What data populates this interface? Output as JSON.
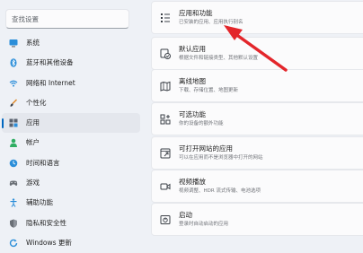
{
  "search": {
    "placeholder": "查找设置"
  },
  "sidebar": {
    "items": [
      {
        "label": "系统",
        "icon": "monitor-icon"
      },
      {
        "label": "蓝牙和其他设备",
        "icon": "bluetooth-icon"
      },
      {
        "label": "网络和 Internet",
        "icon": "wifi-icon"
      },
      {
        "label": "个性化",
        "icon": "paintbrush-icon"
      },
      {
        "label": "应用",
        "icon": "apps-icon",
        "active": true
      },
      {
        "label": "帐户",
        "icon": "person-icon"
      },
      {
        "label": "时间和语言",
        "icon": "globe-clock-icon"
      },
      {
        "label": "游戏",
        "icon": "gamepad-icon"
      },
      {
        "label": "辅助功能",
        "icon": "accessibility-icon"
      },
      {
        "label": "隐私和安全性",
        "icon": "shield-icon"
      },
      {
        "label": "Windows 更新",
        "icon": "update-icon"
      }
    ]
  },
  "cards": [
    {
      "title": "应用和功能",
      "subtitle": "已安装的应用、应用执行别名",
      "icon": "apps-list-icon"
    },
    {
      "title": "默认应用",
      "subtitle": "根据文件和链接类型、其他默认设置",
      "icon": "default-apps-icon"
    },
    {
      "title": "离线地图",
      "subtitle": "下载、存储位置、地图更新",
      "icon": "map-icon"
    },
    {
      "title": "可选功能",
      "subtitle": "你的设备的额外功能",
      "icon": "optional-features-icon"
    },
    {
      "title": "可打开网站的应用",
      "subtitle": "可以在应用而不是浏览器中打开的网站",
      "icon": "open-website-icon"
    },
    {
      "title": "视频播放",
      "subtitle": "视频调整、HDR 流式传输、电池选项",
      "icon": "video-icon"
    },
    {
      "title": "启动",
      "subtitle": "登录时自动启动的应用",
      "icon": "startup-icon"
    }
  ],
  "colors": {
    "accent": "#0067c0",
    "annotation_arrow": "#e3262b"
  }
}
